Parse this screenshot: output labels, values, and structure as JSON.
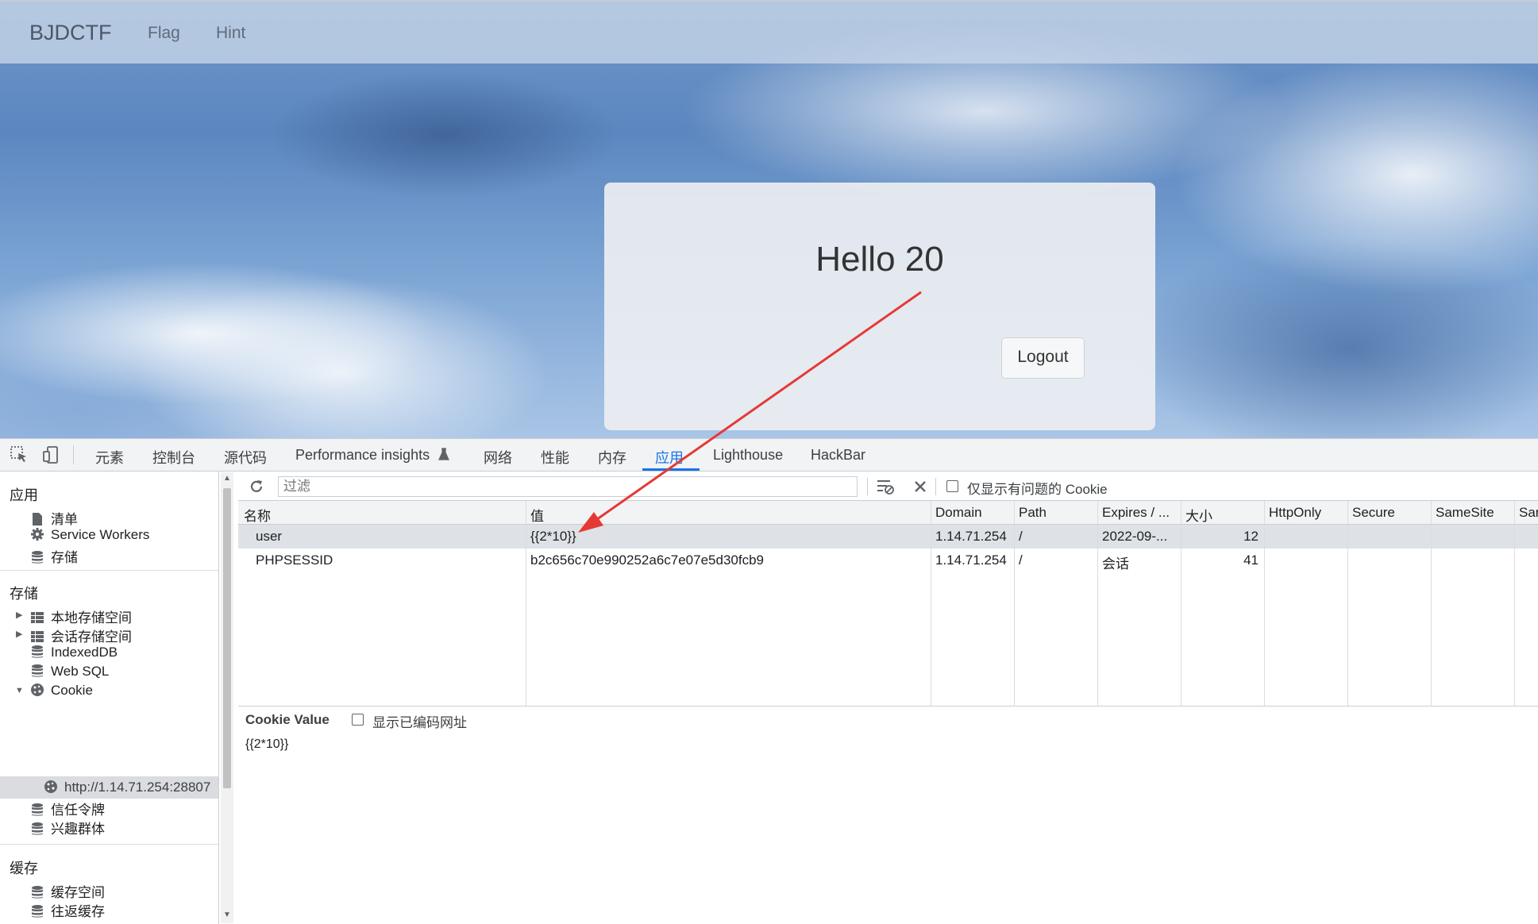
{
  "site": {
    "brand": "BJDCTF",
    "nav": [
      "Flag",
      "Hint"
    ],
    "greeting": "Hello 20",
    "logout_label": "Logout"
  },
  "devtools": {
    "tabs": [
      "元素",
      "控制台",
      "源代码",
      "Performance insights",
      "网络",
      "性能",
      "内存",
      "应用",
      "Lighthouse",
      "HackBar"
    ],
    "active_tab": "应用",
    "sidebar": {
      "app_section": "应用",
      "app_items": [
        "清单",
        "Service Workers",
        "存储"
      ],
      "storage_section": "存储",
      "storage_items": [
        "本地存储空间",
        "会话存储空间",
        "IndexedDB",
        "Web SQL",
        "Cookie"
      ],
      "cookie_origin": "http://1.14.71.254:28807",
      "storage_items_after": [
        "信任令牌",
        "兴趣群体"
      ],
      "cache_section": "缓存",
      "cache_items": [
        "缓存空间",
        "往返缓存"
      ]
    },
    "toolbar": {
      "filter_placeholder": "过滤",
      "only_issues_label": "仅显示有问题的 Cookie"
    },
    "table": {
      "headers": [
        "名称",
        "值",
        "Domain",
        "Path",
        "Expires / ...",
        "大小",
        "HttpOnly",
        "Secure",
        "SameSite",
        "Sar"
      ],
      "rows": [
        {
          "name": "user",
          "value": "{{2*10}}",
          "domain": "1.14.71.254",
          "path": "/",
          "expires": "2022-09-...",
          "size": "12"
        },
        {
          "name": "PHPSESSID",
          "value": "b2c656c70e990252a6c7e07e5d30fcb9",
          "domain": "1.14.71.254",
          "path": "/",
          "expires": "会话",
          "size": "41"
        }
      ],
      "selected_row": 0
    },
    "cookie_value": {
      "label": "Cookie Value",
      "show_encoded_label": "显示已编码网址",
      "value": "{{2*10}}"
    }
  },
  "colors": {
    "accent": "#1a73e8",
    "annotation_arrow": "#e53935"
  }
}
